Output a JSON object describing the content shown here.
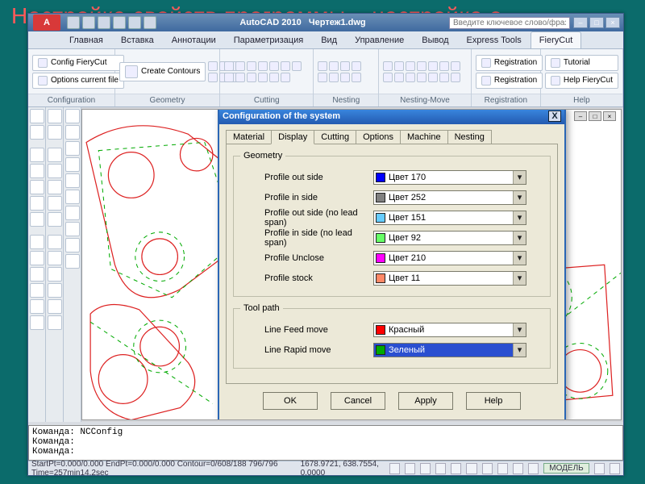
{
  "slide": {
    "title": "Настройка свойств программы – настройка о"
  },
  "titlebar": {
    "logo_text": "A",
    "app": "AutoCAD 2010",
    "doc": "Чертеж1.dwg",
    "search_placeholder": "Введите ключевое слово/фразу",
    "min": "–",
    "max": "□",
    "close": "×"
  },
  "ribbon_tabs": {
    "items": [
      "Главная",
      "Вставка",
      "Аннотации",
      "Параметризация",
      "Вид",
      "Управление",
      "Вывод",
      "Express Tools",
      "FieryCut"
    ],
    "active_index": 8
  },
  "ribbon": {
    "panels": [
      {
        "name": "Configuration",
        "items": [
          "Config FieryCut",
          "Options current file"
        ]
      },
      {
        "name": "Geometry",
        "items": [
          "Create Contours"
        ]
      },
      {
        "name": "Cutting",
        "items": []
      },
      {
        "name": "Nesting",
        "items": []
      },
      {
        "name": "Nesting-Move",
        "items": []
      },
      {
        "name": "Registration",
        "items": [
          "Registration",
          "Registration"
        ]
      },
      {
        "name": "Help",
        "items": [
          "Tutorial",
          "Help FieryCut"
        ]
      }
    ]
  },
  "dialog": {
    "title": "Configuration of the system",
    "close": "X",
    "tabs": [
      "Material",
      "Display",
      "Cutting",
      "Options",
      "Machine",
      "Nesting"
    ],
    "active_tab": 1,
    "groups": {
      "geometry": {
        "legend": "Geometry",
        "rows": [
          {
            "label": "Profile out side",
            "swatch": "#0000ff",
            "value": "Цвет 170"
          },
          {
            "label": "Profile in side",
            "swatch": "#808080",
            "value": "Цвет 252"
          },
          {
            "label": "Profile out side (no lead span)",
            "swatch": "#66ccff",
            "value": "Цвет 151"
          },
          {
            "label": "Profile in side (no lead span)",
            "swatch": "#66ff66",
            "value": "Цвет 92"
          },
          {
            "label": "Profile Unclose",
            "swatch": "#ff00ff",
            "value": "Цвет 210"
          },
          {
            "label": "Profile stock",
            "swatch": "#ff8866",
            "value": "Цвет 11"
          }
        ]
      },
      "toolpath": {
        "legend": "Tool path",
        "rows": [
          {
            "label": "Line Feed move",
            "swatch": "#ff0000",
            "value": "Красный"
          },
          {
            "label": "Line Rapid move",
            "swatch": "#00aa00",
            "value": "Зеленый",
            "selected": true
          }
        ]
      }
    },
    "buttons": {
      "ok": "OK",
      "cancel": "Cancel",
      "apply": "Apply",
      "help": "Help"
    }
  },
  "command": {
    "lines": [
      "Команда: NCConfig",
      "Команда:",
      "Команда:"
    ]
  },
  "statusbar": {
    "left": "StartPt=0.000/0.000   EndPt=0.000/0.000   Contour=0/608/188   796/796 Time=257min14.2sec",
    "coords": "1678.9721, 638.7554, 0.0000",
    "mode": "МОДЕЛЬ"
  },
  "mdi": {
    "min": "–",
    "max": "□",
    "close": "×"
  }
}
